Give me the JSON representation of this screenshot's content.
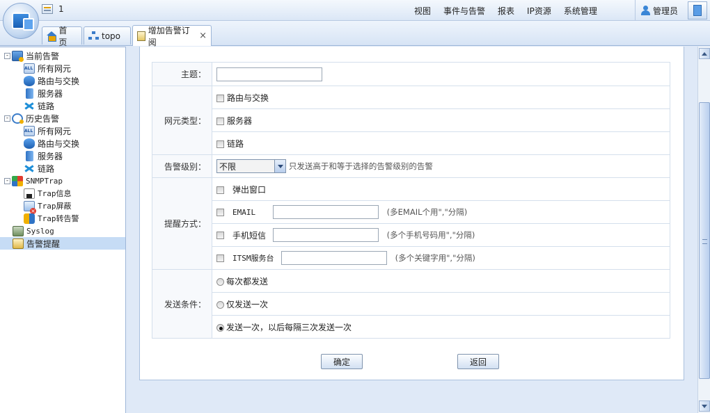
{
  "topbar": {
    "quick_count": "1",
    "menu": [
      "视图",
      "事件与告警",
      "报表",
      "IP资源",
      "系统管理"
    ],
    "user": "管理员"
  },
  "tabs": [
    {
      "label": "首 页",
      "icon": "home-icon"
    },
    {
      "label": "topo",
      "icon": "topology-icon"
    },
    {
      "label": "增加告警订阅",
      "icon": "document-icon",
      "closable": true,
      "close_glyph": "×"
    }
  ],
  "tree": {
    "expander_minus": "-",
    "items": [
      {
        "label": "当前告警",
        "level": 0,
        "icon": "current-alarm-icon"
      },
      {
        "label": "所有网元",
        "level": 1,
        "icon": "all-elements-icon"
      },
      {
        "label": "路由与交换",
        "level": 1,
        "icon": "router-icon"
      },
      {
        "label": "服务器",
        "level": 1,
        "icon": "server-icon"
      },
      {
        "label": "链路",
        "level": 1,
        "icon": "link-icon"
      },
      {
        "label": "历史告警",
        "level": 0,
        "icon": "history-alarm-icon"
      },
      {
        "label": "所有网元",
        "level": 1,
        "icon": "all-elements-icon"
      },
      {
        "label": "路由与交换",
        "level": 1,
        "icon": "router-icon"
      },
      {
        "label": "服务器",
        "level": 1,
        "icon": "server-icon"
      },
      {
        "label": "链路",
        "level": 1,
        "icon": "link-icon"
      },
      {
        "label": "SNMPTrap",
        "level": 0,
        "icon": "snmp-trap-icon"
      },
      {
        "label": "Trap信息",
        "level": 1,
        "icon": "trap-info-icon"
      },
      {
        "label": "Trap屏蔽",
        "level": 1,
        "icon": "trap-block-icon"
      },
      {
        "label": "Trap转告警",
        "level": 1,
        "icon": "trap-convert-icon"
      },
      {
        "label": "Syslog",
        "level": 0,
        "icon": "syslog-icon"
      },
      {
        "label": "告警提醒",
        "level": 0,
        "icon": "alarm-remind-icon",
        "selected": true
      }
    ]
  },
  "form": {
    "subject_label": "主题：",
    "subject_value": "",
    "element_type_label": "网元类型：",
    "element_types": [
      "路由与交换",
      "服务器",
      "链路"
    ],
    "level_label": "告警级别：",
    "level_selected": "不限",
    "level_hint": "只发送高于和等于选择的告警级别的告警",
    "notify_label": "提醒方式：",
    "notify_popup": "弹出窗口",
    "notify_email": "EMAIL",
    "notify_email_hint": "(多EMAIL个用\",\"分隔)",
    "notify_sms": "手机短信",
    "notify_sms_hint": "(多个手机号码用\",\"分隔)",
    "notify_itsm": "ITSM服务台",
    "notify_itsm_hint": "(多个关键字用\",\"分隔)",
    "send_label": "发送条件：",
    "send_options": [
      "每次都发送",
      "仅发送一次",
      "发送一次，以后每隔三次发送一次"
    ],
    "send_selected_index": 2
  },
  "buttons": {
    "confirm": "确定",
    "back": "返回"
  }
}
